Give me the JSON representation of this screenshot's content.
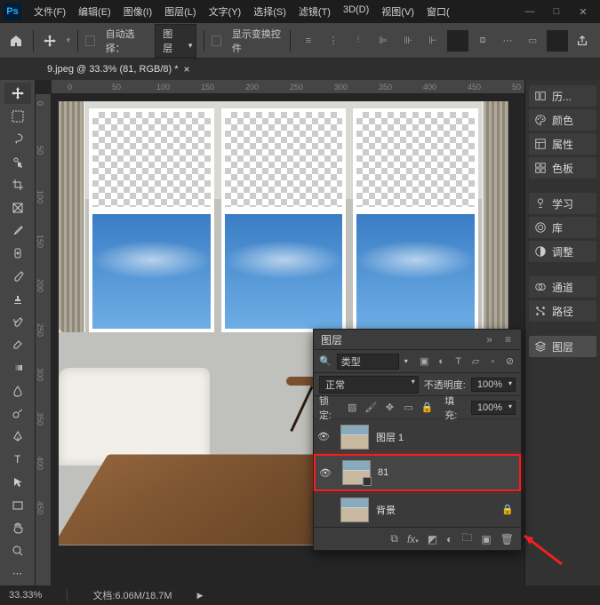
{
  "app": {
    "logo": "Ps"
  },
  "menu": [
    "文件(F)",
    "编辑(E)",
    "图像(I)",
    "图层(L)",
    "文字(Y)",
    "选择(S)",
    "滤镜(T)",
    "3D(D)",
    "视图(V)",
    "窗口("
  ],
  "win_controls": [
    "—",
    "□",
    "✕"
  ],
  "options": {
    "auto_select_label": "自动选择：",
    "auto_select_value": "图层",
    "show_transform_label": "显示变换控件"
  },
  "doc_tab": {
    "title": "9.jpeg @ 33.3% (81, RGB/8) *"
  },
  "ruler_h": [
    "0",
    "50",
    "100",
    "150",
    "200",
    "250",
    "300",
    "350",
    "400",
    "450",
    "50"
  ],
  "ruler_v": [
    "0",
    "50",
    "100",
    "150",
    "200",
    "250",
    "300",
    "350",
    "400",
    "450"
  ],
  "right_panels_1": [
    {
      "icon": "history",
      "label": "历..."
    },
    {
      "icon": "color",
      "label": "颜色"
    },
    {
      "icon": "properties",
      "label": "属性"
    },
    {
      "icon": "swatches",
      "label": "色板"
    }
  ],
  "right_panels_2": [
    {
      "icon": "learn",
      "label": "学习"
    },
    {
      "icon": "cc",
      "label": "库"
    },
    {
      "icon": "adjust",
      "label": "调整"
    }
  ],
  "right_panels_3": [
    {
      "icon": "channels",
      "label": "通道"
    },
    {
      "icon": "paths",
      "label": "路径"
    }
  ],
  "right_panels_4": [
    {
      "icon": "layers",
      "label": "图层"
    }
  ],
  "layers": {
    "panel_title": "图层",
    "filter_placeholder": "类型",
    "blend_mode": "正常",
    "opacity_label": "不透明度:",
    "opacity_value": "100%",
    "lock_label": "锁定:",
    "fill_label": "填充:",
    "fill_value": "100%",
    "items": [
      {
        "name": "图层 1",
        "selected": false,
        "locked": false
      },
      {
        "name": "81",
        "selected": true,
        "locked": false,
        "smart": true
      },
      {
        "name": "背景",
        "selected": false,
        "locked": true
      }
    ]
  },
  "status": {
    "zoom": "33.33%",
    "doc_label": "文档:",
    "doc_size": "6.06M/18.7M"
  }
}
